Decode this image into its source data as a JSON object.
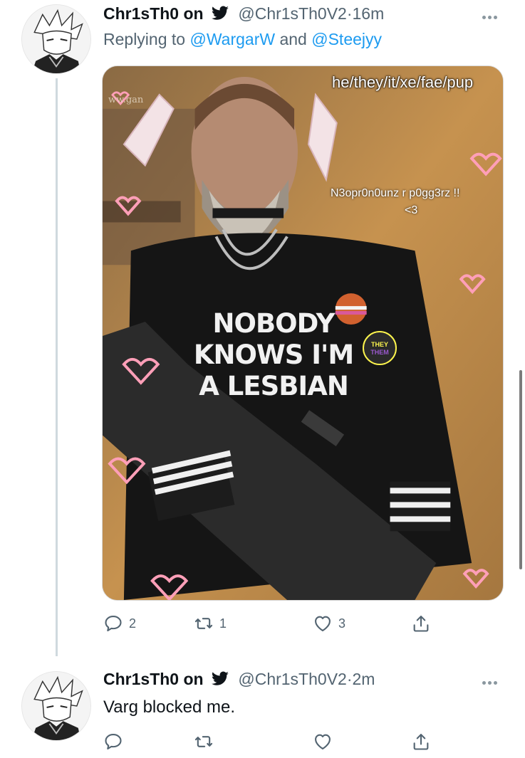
{
  "tweets": [
    {
      "display_name": "Chr1sTh0 on",
      "handle": "@Chr1sTh0V2",
      "dot": "·",
      "time": "16m",
      "reply_prefix": "Replying to",
      "reply_to_1": "@WargarW",
      "reply_and": "and",
      "reply_to_2": "@Steejyy",
      "media": {
        "pronouns_caption": "he/they/it/xe/fae/pup",
        "neopronouns_caption": "N3opr0n0unz r p0gg3rz !!",
        "heart_caption": "<3",
        "watermark": "ww.gan",
        "shirt_lines": [
          "NOBODY",
          "KNOWS I'M",
          "A LESBIAN"
        ],
        "badge_top": "THEY",
        "badge_bottom": "THEM"
      },
      "actions": {
        "reply_count": "2",
        "retweet_count": "1",
        "like_count": "3"
      }
    },
    {
      "display_name": "Chr1sTh0 on",
      "handle": "@Chr1sTh0V2",
      "dot": "·",
      "time": "2m",
      "text": "Varg blocked me.",
      "actions": {
        "reply_count": "",
        "retweet_count": "",
        "like_count": ""
      }
    }
  ],
  "icons": {
    "bird": "twitter-bird-icon",
    "more": "more-dots-icon",
    "reply": "reply-icon",
    "retweet": "retweet-icon",
    "like": "heart-icon",
    "share": "share-icon"
  },
  "colors": {
    "link": "#1d9bf0",
    "secondary_text": "#536471",
    "thread_line": "#cfd9de"
  }
}
